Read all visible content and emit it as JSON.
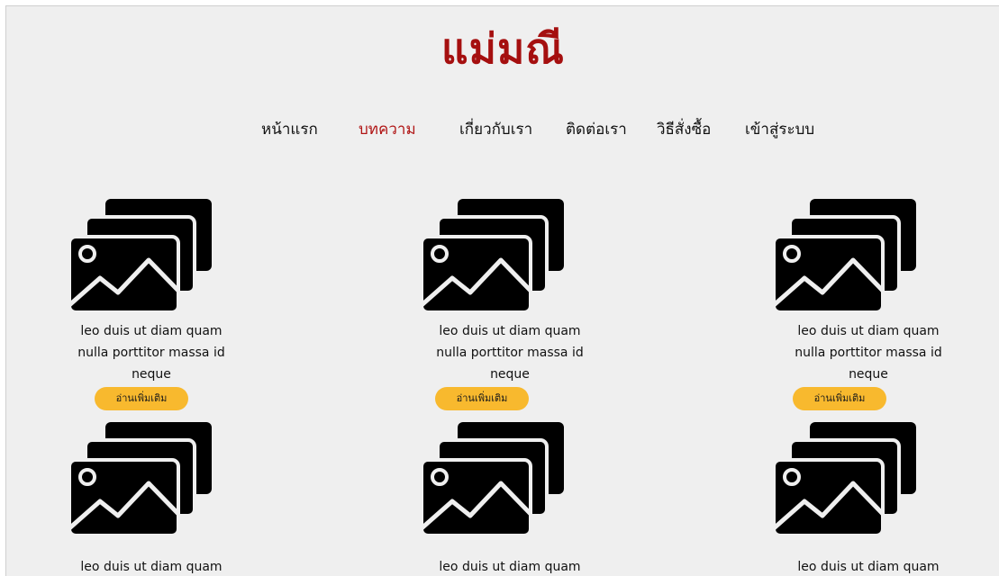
{
  "brand": {
    "title": "แม่มณี"
  },
  "nav": {
    "items": [
      {
        "label": "หน้าแรก"
      },
      {
        "label": "บทความ",
        "active": true
      },
      {
        "label": "เกี่ยวกับเรา"
      },
      {
        "label": "ติดต่อเรา"
      },
      {
        "label": "วิธีสั่งซื้อ"
      },
      {
        "label": "เข้าสู่ระบบ"
      }
    ]
  },
  "colors": {
    "brand": "#a50f0f",
    "active_nav": "#b01414",
    "button": "#f8b92e",
    "background": "#efefef"
  },
  "articles": [
    {
      "icon": "images-icon",
      "lines": [
        "leo duis ut diam quam",
        "nulla porttitor massa id",
        "neque"
      ],
      "button_label": "อ่านเพิ่มเติม"
    },
    {
      "icon": "images-icon",
      "lines": [
        "leo duis ut diam quam",
        "nulla porttitor massa id",
        "neque"
      ],
      "button_label": "อ่านเพิ่มเติม"
    },
    {
      "icon": "images-icon",
      "lines": [
        "leo duis ut diam quam",
        "nulla porttitor massa id",
        "neque"
      ],
      "button_label": "อ่านเพิ่มเติม"
    },
    {
      "icon": "images-icon",
      "lines": [
        "leo duis ut diam quam"
      ]
    },
    {
      "icon": "images-icon",
      "lines": [
        "leo duis ut diam quam"
      ]
    },
    {
      "icon": "images-icon",
      "lines": [
        "leo duis ut diam quam"
      ]
    }
  ]
}
